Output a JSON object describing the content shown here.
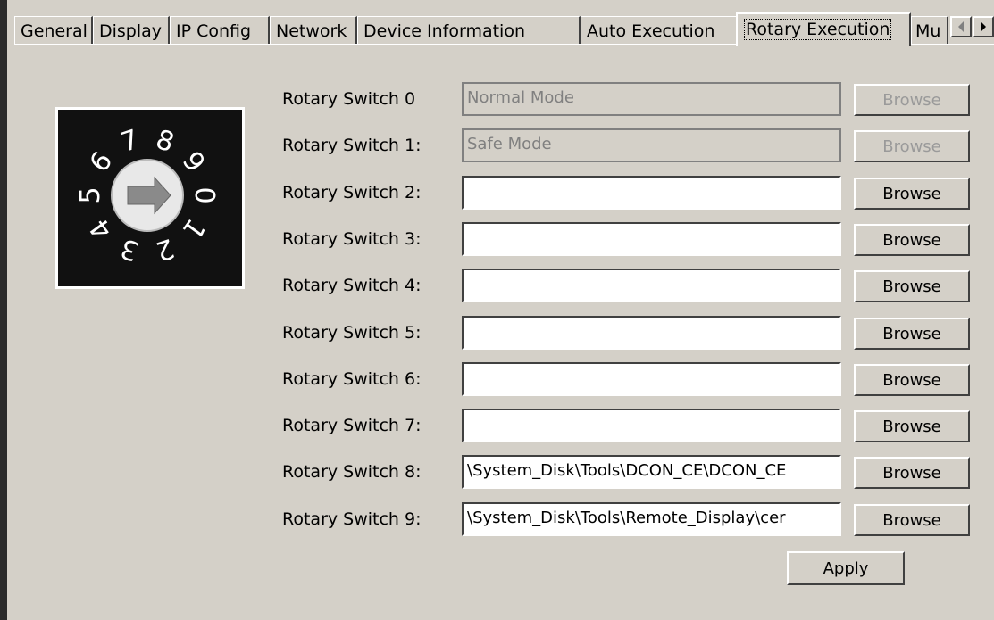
{
  "tabs": [
    {
      "label": "General"
    },
    {
      "label": "Display"
    },
    {
      "label": "IP Config"
    },
    {
      "label": "Network"
    },
    {
      "label": "Device Information"
    },
    {
      "label": "Auto Execution"
    },
    {
      "label": "Rotary Execution"
    },
    {
      "label": "Mu"
    }
  ],
  "active_tab": "Rotary Execution",
  "rotary_image": {
    "digits": [
      "0",
      "1",
      "2",
      "3",
      "4",
      "5",
      "6",
      "7",
      "8",
      "9"
    ]
  },
  "switches": [
    {
      "label": "Rotary Switch 0",
      "value": "Normal Mode",
      "disabled": true,
      "button": "Browse"
    },
    {
      "label": "Rotary Switch 1:",
      "value": "Safe Mode",
      "disabled": true,
      "button": "Browse"
    },
    {
      "label": "Rotary Switch 2:",
      "value": "",
      "disabled": false,
      "button": "Browse"
    },
    {
      "label": "Rotary Switch 3:",
      "value": "",
      "disabled": false,
      "button": "Browse"
    },
    {
      "label": "Rotary Switch 4:",
      "value": "",
      "disabled": false,
      "button": "Browse"
    },
    {
      "label": "Rotary Switch 5:",
      "value": "",
      "disabled": false,
      "button": "Browse"
    },
    {
      "label": "Rotary Switch 6:",
      "value": "",
      "disabled": false,
      "button": "Browse"
    },
    {
      "label": "Rotary Switch 7:",
      "value": "",
      "disabled": false,
      "button": "Browse"
    },
    {
      "label": "Rotary Switch 8:",
      "value": "\\System_Disk\\Tools\\DCON_CE\\DCON_CE",
      "disabled": false,
      "button": "Browse"
    },
    {
      "label": "Rotary Switch 9:",
      "value": "\\System_Disk\\Tools\\Remote_Display\\cer",
      "disabled": false,
      "button": "Browse"
    }
  ],
  "apply_label": "Apply"
}
